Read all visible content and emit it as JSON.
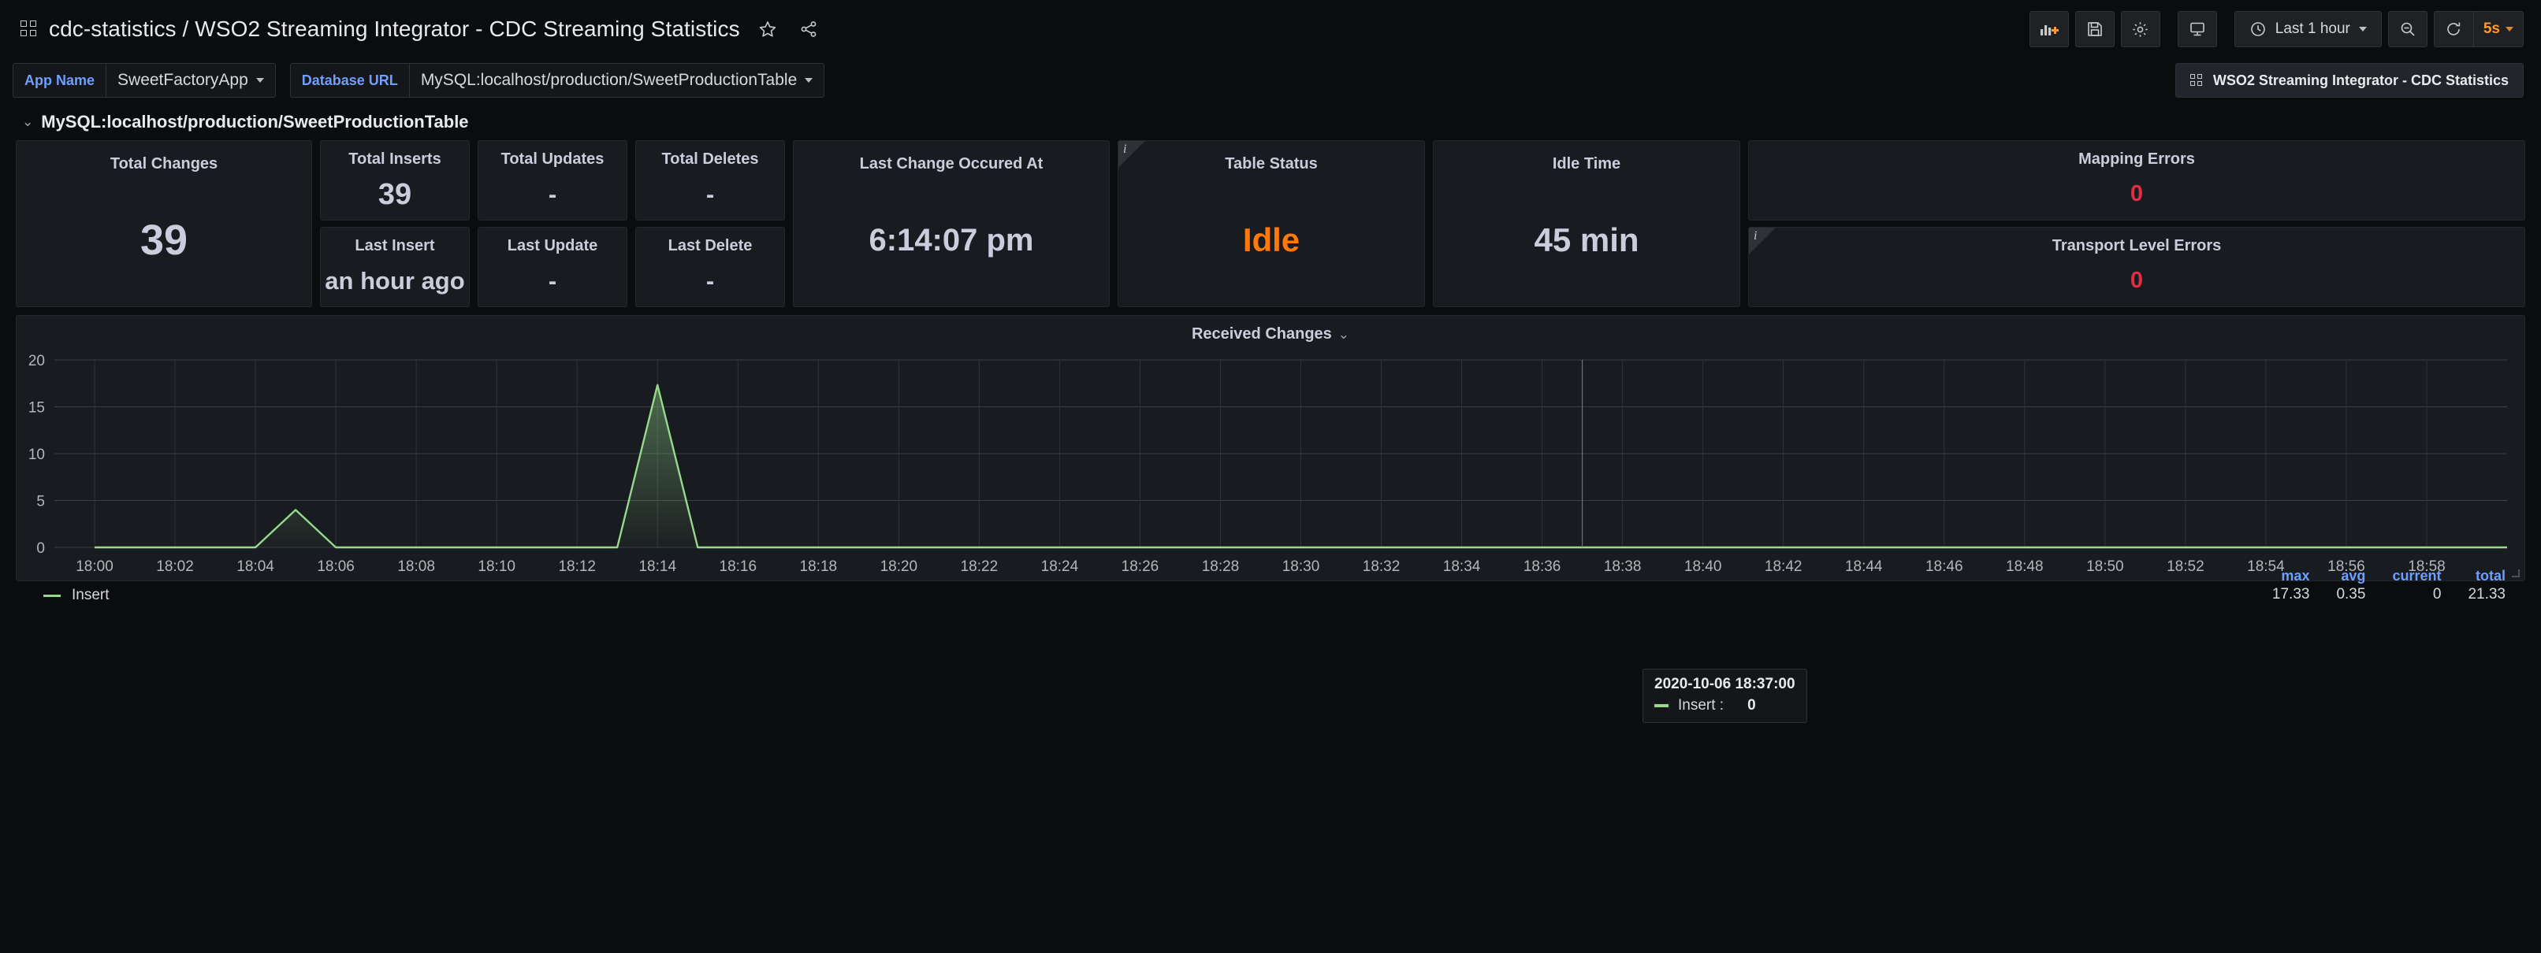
{
  "header": {
    "breadcrumb": "cdc-statistics / WSO2 Streaming Integrator - CDC Streaming Statistics",
    "star_icon": "star-icon",
    "share_icon": "share-icon",
    "add_panel_icon": "add-panel-icon",
    "save_icon": "save-dashboard-icon",
    "settings_icon": "dashboard-settings-icon",
    "tv_icon": "cycle-view-mode-icon",
    "clock_icon": "clock-icon",
    "time_range": "Last 1 hour",
    "zoom_out_icon": "zoom-out-icon",
    "refresh_icon": "refresh-icon",
    "refresh_interval": "5s"
  },
  "variables": [
    {
      "label": "App Name",
      "value": "SweetFactoryApp"
    },
    {
      "label": "Database URL",
      "value": "MySQL:localhost/production/SweetProductionTable"
    }
  ],
  "dashboard_link": {
    "icon": "grid-icon",
    "label": "WSO2 Streaming Integrator - CDC Statistics"
  },
  "row": {
    "caret": "⌄",
    "title": "MySQL:localhost/production/SweetProductionTable"
  },
  "panels": {
    "total_changes": {
      "title": "Total Changes",
      "value": "39"
    },
    "total_inserts": {
      "title": "Total Inserts",
      "value": "39"
    },
    "last_insert": {
      "title": "Last Insert",
      "value": "an hour ago"
    },
    "total_updates": {
      "title": "Total Updates",
      "value": "-"
    },
    "last_update": {
      "title": "Last Update",
      "value": "-"
    },
    "total_deletes": {
      "title": "Total Deletes",
      "value": "-"
    },
    "last_delete": {
      "title": "Last Delete",
      "value": "-"
    },
    "last_change": {
      "title": "Last Change Occured At",
      "value": "6:14:07 pm"
    },
    "table_status": {
      "title": "Table Status",
      "value": "Idle",
      "info": "i"
    },
    "idle_time": {
      "title": "Idle Time",
      "value": "45 min"
    },
    "mapping_errors": {
      "title": "Mapping Errors",
      "value": "0"
    },
    "transport_errors": {
      "title": "Transport Level Errors",
      "value": "0",
      "info": "i"
    }
  },
  "graph": {
    "title": "Received Changes",
    "caret": "⌄",
    "legend_series": "Insert",
    "stat_headers": [
      "max",
      "avg",
      "current",
      "total"
    ],
    "stat_values": [
      "17.33",
      "0.35",
      "0",
      "21.33"
    ],
    "tooltip": {
      "time": "2020-10-06 18:37:00",
      "series": "Insert :",
      "value": "0"
    }
  },
  "colors": {
    "series_green": "#96d98d",
    "accent_orange": "#ff780a",
    "accent_blue": "#6e9fff",
    "error_red": "#e02f44",
    "panel_bg": "#181b1f",
    "page_bg": "#0b0c0e"
  },
  "chart_data": {
    "type": "area",
    "title": "Received Changes",
    "xlabel": "",
    "ylabel": "",
    "ylim": [
      0,
      20
    ],
    "yticks": [
      0,
      5,
      10,
      15,
      20
    ],
    "grid": true,
    "legend_position": "bottom-left",
    "xticks": [
      "18:00",
      "18:02",
      "18:04",
      "18:06",
      "18:08",
      "18:10",
      "18:12",
      "18:14",
      "18:16",
      "18:18",
      "18:20",
      "18:22",
      "18:24",
      "18:26",
      "18:28",
      "18:30",
      "18:32",
      "18:34",
      "18:36",
      "18:38",
      "18:40",
      "18:42",
      "18:44",
      "18:46",
      "18:48",
      "18:50",
      "18:52",
      "18:54",
      "18:56",
      "18:58"
    ],
    "series": [
      {
        "name": "Insert",
        "color": "#96d98d",
        "max": 17.33,
        "avg": 0.35,
        "current": 0,
        "total": 21.33,
        "x": [
          "18:00",
          "18:01",
          "18:02",
          "18:03",
          "18:04",
          "18:05",
          "18:06",
          "18:07",
          "18:08",
          "18:09",
          "18:10",
          "18:11",
          "18:12",
          "18:13",
          "18:14",
          "18:15",
          "18:16",
          "18:17",
          "18:18",
          "18:20",
          "18:22",
          "18:24",
          "18:26",
          "18:28",
          "18:30",
          "18:32",
          "18:34",
          "18:36",
          "18:38",
          "18:40",
          "18:42",
          "18:44",
          "18:46",
          "18:48",
          "18:50",
          "18:52",
          "18:54",
          "18:56",
          "18:58",
          "19:00"
        ],
        "y": [
          0,
          0,
          0,
          0,
          0,
          4,
          0,
          0,
          0,
          0,
          0,
          0,
          0,
          0,
          17.33,
          0,
          0,
          0,
          0,
          0,
          0,
          0,
          0,
          0,
          0,
          0,
          0,
          0,
          0,
          0,
          0,
          0,
          0,
          0,
          0,
          0,
          0,
          0,
          0,
          0
        ]
      }
    ]
  }
}
